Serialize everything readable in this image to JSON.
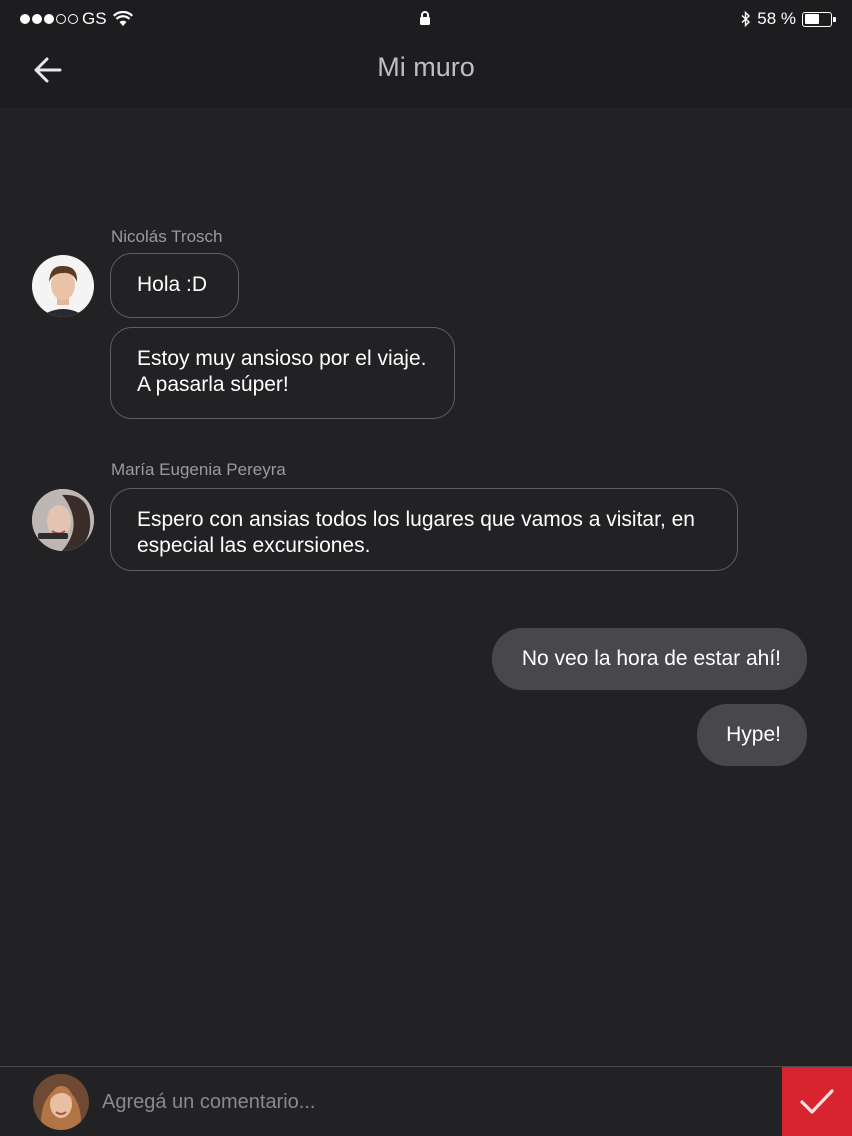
{
  "status_bar": {
    "carrier": "GS",
    "battery": "58 %",
    "battery_level": 0.58
  },
  "header": {
    "title": "Mi muro",
    "back_icon": "arrow-left-icon"
  },
  "conversation": {
    "groups": [
      {
        "sender": "Nicolás Trosch",
        "messages": [
          "Hola :D",
          "Estoy muy ansioso por el viaje.\nA pasarla súper!"
        ]
      },
      {
        "sender": "María Eugenia Pereyra",
        "messages": [
          "Espero con ansias todos los lugares que vamos a visitar, en especial las excursiones."
        ]
      }
    ],
    "own_messages": [
      "No veo la hora de estar ahí!",
      "Hype!"
    ]
  },
  "composer": {
    "placeholder": "Agregá un comentario...",
    "send_icon": "checkmark-icon",
    "send_color": "#d8242f"
  }
}
